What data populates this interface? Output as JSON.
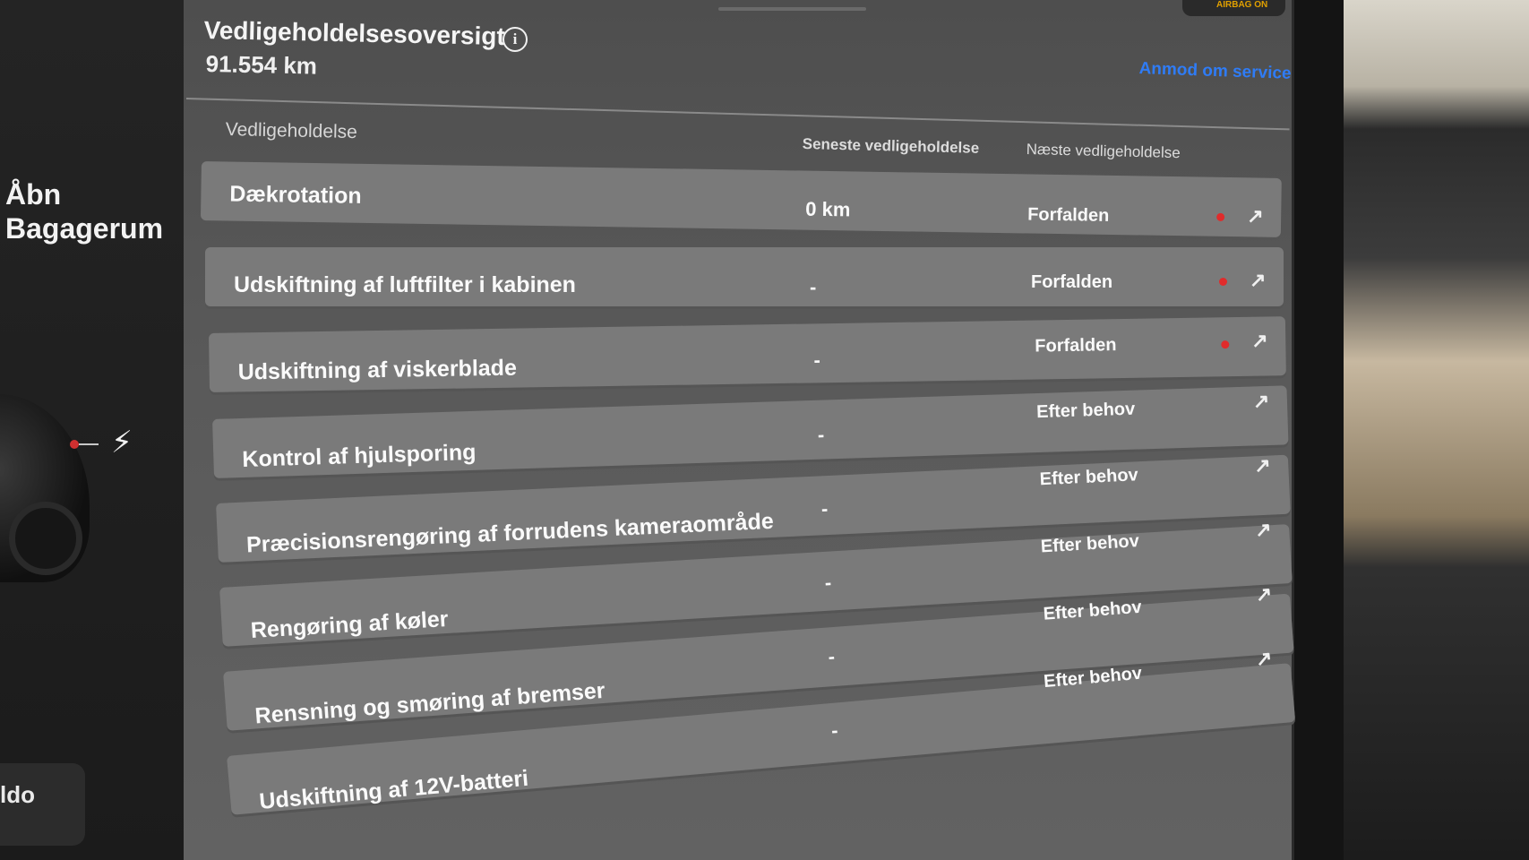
{
  "sidebar": {
    "trunk_line1": "Åbn",
    "trunk_line2": "Bagagerum",
    "button_partial": "ldo"
  },
  "status_bar": {
    "airbag": "AIRBAG ON"
  },
  "header": {
    "title": "Vedligeholdelsesoversigt",
    "odometer": "91.554  km",
    "request_service": "Anmod om service"
  },
  "table": {
    "section_label": "Vedligeholdelse",
    "col_last": "Seneste vedligeholdelse",
    "col_next": "Næste vedligeholdelse",
    "rows": [
      {
        "name": "Dækrotation",
        "last": "0 km",
        "next": "Forfalden",
        "overdue": true
      },
      {
        "name": "Udskiftning af luftfilter i kabinen",
        "last": "-",
        "next": "Forfalden",
        "overdue": true
      },
      {
        "name": "Udskiftning af viskerblade",
        "last": "-",
        "next": "Forfalden",
        "overdue": true
      },
      {
        "name": "Kontrol af hjulsporing",
        "last": "-",
        "next": "Efter behov",
        "overdue": false
      },
      {
        "name": "Præcisionsrengøring af forrudens kameraområde",
        "last": "-",
        "next": "Efter behov",
        "overdue": false
      },
      {
        "name": "Rengøring af køler",
        "last": "-",
        "next": "Efter behov",
        "overdue": false
      },
      {
        "name": "Rensning og smøring af bremser",
        "last": "-",
        "next": "Efter behov",
        "overdue": false
      },
      {
        "name": "Udskiftning af 12V-batteri",
        "last": "-",
        "next": "Efter behov",
        "overdue": false
      }
    ]
  },
  "colors": {
    "link": "#2f7cf6",
    "overdue_dot": "#e02b2b"
  },
  "icons": {
    "info": "info-icon",
    "external": "arrow-up-right-icon",
    "charge": "lightning-bolt-icon"
  }
}
